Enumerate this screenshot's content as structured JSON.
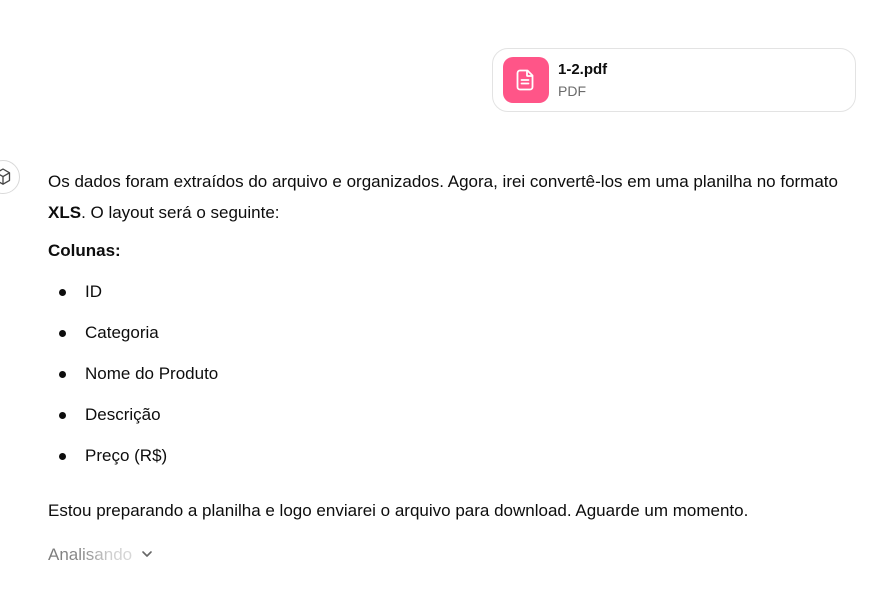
{
  "attachment": {
    "file_name": "1-2.pdf",
    "file_type": "PDF",
    "icon": "document-icon",
    "icon_color": "#ff5588"
  },
  "assistant": {
    "avatar_icon": "assistant-logo-icon",
    "paragraph_1_before": "Os dados foram extraídos do arquivo e organizados. Agora, irei convertê-los em uma planilha no formato ",
    "paragraph_1_bold": "XLS",
    "paragraph_1_after": ". O layout será o seguinte:",
    "columns_heading": "Colunas:",
    "columns": [
      "ID",
      "Categoria",
      "Nome do Produto",
      "Descrição",
      "Preço (R$)"
    ],
    "paragraph_2": "Estou preparando a planilha e logo enviarei o arquivo para download. Aguarde um momento.",
    "status": "Analisando"
  }
}
